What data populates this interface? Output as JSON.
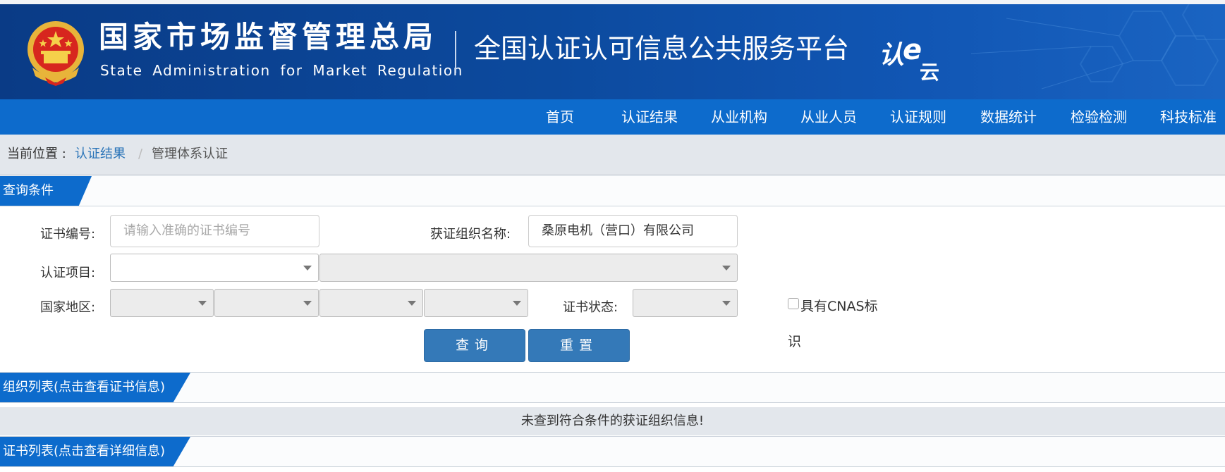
{
  "header": {
    "org_name_cn": "国家市场监督管理总局",
    "org_name_en": "State Administration for Market Regulation",
    "platform_title": "全国认证认可信息公共服务平台",
    "logo_text": "认e云"
  },
  "nav": {
    "items": [
      "首页",
      "认证结果",
      "从业机构",
      "从业人员",
      "认证规则",
      "数据统计",
      "检验检测",
      "科技标准"
    ]
  },
  "breadcrumb": {
    "label": "当前位置 :",
    "link": "认证结果",
    "separator": "/",
    "current": "管理体系认证"
  },
  "query": {
    "section_title": "查询条件",
    "cert_no_label": "证书编号:",
    "cert_no_placeholder": "请输入准确的证书编号",
    "org_name_label": "获证组织名称:",
    "org_name_value": "桑原电机（营口）有限公司",
    "cert_item_label": "认证项目:",
    "region_label": "国家地区:",
    "cert_status_label": "证书状态:",
    "cnas_label_part1": "具有CNAS标",
    "cnas_label_part2": "识",
    "search_button": "查询",
    "reset_button": "重置"
  },
  "org_list": {
    "section_title": "组织列表(点击查看证书信息)",
    "empty_message": "未查到符合条件的获证组织信息!"
  },
  "cert_list": {
    "section_title": "证书列表(点击查看详细信息)"
  },
  "colors": {
    "banner_dark": "#0a3b86",
    "nav_blue": "#0d6bcc",
    "button_blue": "#3479b8",
    "link_blue": "#2a74b8"
  }
}
